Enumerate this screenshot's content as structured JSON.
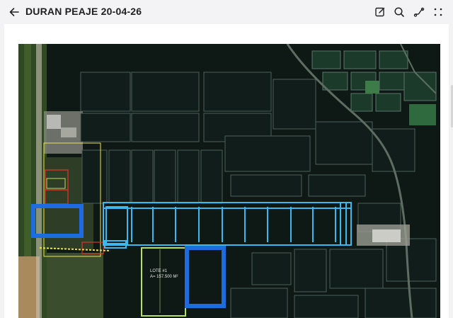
{
  "header": {
    "title": "DURAN PEAJE 20-04-26",
    "back_icon": "arrow-left-icon",
    "tools": [
      "edit-icon",
      "search-icon",
      "draw-icon",
      "more-icon"
    ]
  },
  "map": {
    "lote_label": "LOTE #1",
    "lote_area": "A= 157.500 M²",
    "colors": {
      "highlight_blue": "#1e6de0",
      "parcel_cyan": "#3cb8ee",
      "lote_green": "#b9e05a",
      "red_parcel": "#e0342a",
      "yellow_outline": "#f1e24a"
    }
  }
}
